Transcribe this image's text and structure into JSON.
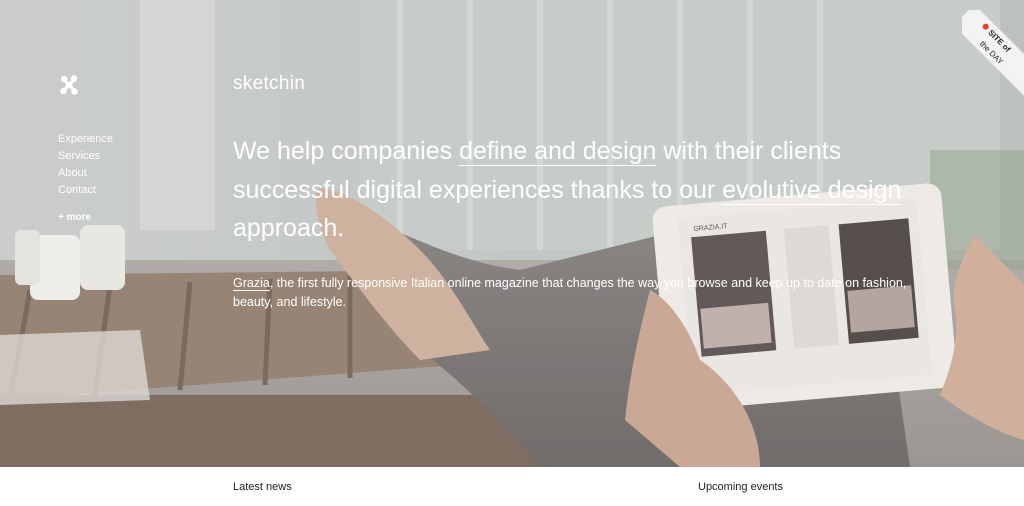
{
  "brand": {
    "name": "sketchin"
  },
  "nav": {
    "items": [
      {
        "label": "Experience"
      },
      {
        "label": "Services"
      },
      {
        "label": "About"
      },
      {
        "label": "Contact"
      }
    ],
    "more_label": "+ more"
  },
  "hero": {
    "headline": {
      "part1": "We help companies ",
      "link1": "define and design",
      "part2": " with their clients successful digital experiences thanks to our ",
      "link2": "evolutive design",
      "part3": " approach."
    },
    "feature": {
      "link": "Grazia",
      "text": ", the first fully responsive Italian online magazine that changes the way you browse and keep up to date on fashion, beauty, and lifestyle."
    },
    "tablet_logo": "GRAZIA.IT"
  },
  "badge": {
    "line1": "SITE of",
    "line2": "the DAY"
  },
  "sections": {
    "latest_news": "Latest news",
    "upcoming_events": "Upcoming events"
  },
  "colors": {
    "text_light": "#ffffff",
    "text_dark": "#222222",
    "badge_accent": "#e0412b"
  }
}
